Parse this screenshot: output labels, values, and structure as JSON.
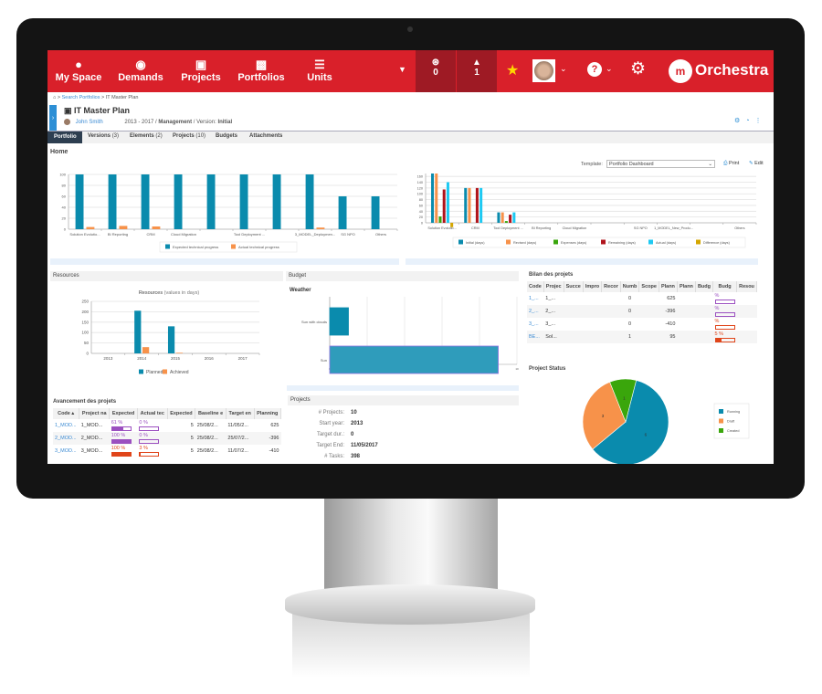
{
  "header": {
    "nav": [
      {
        "label": "My Space",
        "icon": "user-icon"
      },
      {
        "label": "Demands",
        "icon": "lightbulb-icon"
      },
      {
        "label": "Projects",
        "icon": "briefcase-icon"
      },
      {
        "label": "Portfolios",
        "icon": "portfolio-icon"
      },
      {
        "label": "Units",
        "icon": "org-chart-icon"
      }
    ],
    "rss_count": "0",
    "notif_count": "1",
    "brand": "Orchestra",
    "brand_color": "#d9202a"
  },
  "breadcrumb": {
    "link": "Search Portfolios",
    "sep": ">",
    "current": "IT Master Plan"
  },
  "portfolio": {
    "title": "IT Master Plan",
    "owner": "John Smith",
    "meta_prefix": "2013 - 2017 / ",
    "meta_type": "Management",
    "meta_version_label": " / Version: ",
    "meta_version": "Initial"
  },
  "tabs": [
    {
      "label": "Portfolio",
      "count": ""
    },
    {
      "label": "Versions",
      "count": "(3)"
    },
    {
      "label": "Elements",
      "count": "(2)"
    },
    {
      "label": "Projects",
      "count": "(10)"
    },
    {
      "label": "Budgets",
      "count": ""
    },
    {
      "label": "Attachments",
      "count": ""
    }
  ],
  "home": {
    "title": "Home",
    "template_label": "Template:",
    "template_value": "Portfolio Dashboard",
    "print": "Print",
    "edit": "Edit"
  },
  "panels": {
    "resources": "Resources",
    "budget": "Budget",
    "weather": "Weather",
    "bilan": "Bilan des projets",
    "status": "Project Status",
    "avancement": "Avancement des projets",
    "projects": "Projects"
  },
  "chart_data": [
    {
      "type": "bar",
      "categories": [
        "Solution Evolutio...",
        "BI Reporting",
        "CRM",
        "Cloud Migration",
        "",
        "Tool Deployment ...",
        "",
        "3_MODEL_Deploymen...",
        "SG NPO",
        "Others"
      ],
      "series": [
        {
          "name": "Expected technical progress",
          "color": "#0a8bad",
          "values": [
            100,
            100,
            100,
            100,
            100,
            100,
            100,
            100,
            60,
            60
          ]
        },
        {
          "name": "Actual technical progress",
          "color": "#f7924a",
          "values": [
            4,
            6,
            5,
            0,
            0,
            0,
            0,
            3,
            0,
            0
          ]
        }
      ],
      "yticks": [
        0,
        20,
        40,
        60,
        80,
        100
      ],
      "ylim": [
        0,
        100
      ],
      "grid": true,
      "legend": "bottom"
    },
    {
      "type": "bar",
      "categories": [
        "Solution Evolutio...",
        "CRM",
        "Tool Deployment ...",
        "BI Reporting",
        "Cloud Migration",
        "",
        "SG NPO",
        "1_MODEL_New_Produ...",
        "",
        "Others"
      ],
      "series": [
        {
          "name": "Initial (days)",
          "color": "#0a8bad",
          "values": [
            170,
            120,
            36,
            0,
            0,
            0,
            0,
            0,
            0,
            0
          ]
        },
        {
          "name": "Revised (days)",
          "color": "#f7924a",
          "values": [
            170,
            120,
            36,
            0,
            0,
            0,
            0,
            0,
            0,
            0
          ]
        },
        {
          "name": "Expenses (days)",
          "color": "#3aa60c",
          "values": [
            22,
            0,
            6,
            0,
            0,
            0,
            0,
            0,
            0,
            0
          ]
        },
        {
          "name": "Remaining (days)",
          "color": "#b0141c",
          "values": [
            115,
            120,
            28,
            0,
            0,
            0,
            0,
            0,
            0,
            0
          ]
        },
        {
          "name": "Actual (days)",
          "color": "#1ec9f2",
          "values": [
            140,
            120,
            36,
            0,
            0,
            0,
            0,
            0,
            0,
            0
          ]
        },
        {
          "name": "Difference (days)",
          "color": "#d4a600",
          "values": [
            -15,
            0,
            0,
            0,
            0,
            0,
            0,
            0,
            0,
            0
          ]
        }
      ],
      "yticks": [
        0,
        20,
        40,
        60,
        80,
        100,
        120,
        140,
        160
      ],
      "ylim": [
        0,
        170
      ],
      "grid": true,
      "legend": "bottom"
    },
    {
      "type": "bar",
      "title": "Resources",
      "subtitle": "(values in days)",
      "categories": [
        "2013",
        "2014",
        "2015",
        "2016",
        "2017"
      ],
      "series": [
        {
          "name": "Planned",
          "color": "#0a8bad",
          "values": [
            0,
            205,
            130,
            0,
            0
          ]
        },
        {
          "name": "Achieved",
          "color": "#f7924a",
          "values": [
            0,
            30,
            3,
            0,
            0
          ]
        }
      ],
      "yticks": [
        0,
        50,
        100,
        150,
        200,
        250
      ],
      "ylim": [
        0,
        250
      ],
      "grid": true,
      "legend": "bottom"
    },
    {
      "type": "bar",
      "orientation": "horizontal",
      "categories": [
        "Sun with clouds",
        "Sun"
      ],
      "values": [
        1,
        9
      ],
      "xlim": [
        0,
        10
      ],
      "grid": true
    },
    {
      "type": "pie",
      "labels": [
        "Running",
        "Draft",
        "Created"
      ],
      "values": [
        6,
        3,
        1
      ],
      "colors": [
        "#0a8bad",
        "#f7924a",
        "#3aa60c"
      ],
      "legend": "right"
    }
  ],
  "avancement": {
    "columns": [
      "Code",
      "Project na",
      "Expected",
      "Actual tec",
      "Expected",
      "Baseline e",
      "Target en",
      "Planning"
    ],
    "rows": [
      {
        "code": "1_MOD...",
        "name": "1_MOD...",
        "exp": "61 %",
        "exp_pct": 61,
        "act": "0 %",
        "act_pct": 0,
        "n": "5",
        "base": "25/08/2...",
        "target": "11/05/2...",
        "plan": "625",
        "color": "#9b4fc0"
      },
      {
        "code": "2_MOD...",
        "name": "2_MOD...",
        "exp": "100 %",
        "exp_pct": 100,
        "act": "0 %",
        "act_pct": 0,
        "n": "5",
        "base": "25/08/2...",
        "target": "25/07/2...",
        "plan": "-396",
        "color": "#9b4fc0"
      },
      {
        "code": "3_MOD...",
        "name": "3_MOD...",
        "exp": "100 %",
        "exp_pct": 100,
        "act": "3 %",
        "act_pct": 3,
        "n": "5",
        "base": "25/08/2...",
        "target": "11/07/2...",
        "plan": "-410",
        "color": "#e0451a"
      }
    ]
  },
  "projects_info": [
    {
      "k": "# Projects:",
      "v": "10"
    },
    {
      "k": "Start year:",
      "v": "2013"
    },
    {
      "k": "Target dur.:",
      "v": "0"
    },
    {
      "k": "Target End:",
      "v": "11/05/2017"
    },
    {
      "k": "# Tasks:",
      "v": "398"
    }
  ],
  "bilan": {
    "columns": [
      "Code",
      "Projec",
      "Succe",
      "Impro",
      "Recor",
      "Numb",
      "Scope",
      "Plann",
      "Plann",
      "Budg",
      "Budg",
      "Resou"
    ],
    "rows": [
      {
        "code": "1_...",
        "name": "1_...",
        "num": "0",
        "plan": "625",
        "budget": "%",
        "pct": 0,
        "color": "#9b4fc0"
      },
      {
        "code": "2_...",
        "name": "2_...",
        "num": "0",
        "plan": "-396",
        "budget": "%",
        "pct": 0,
        "color": "#9b4fc0"
      },
      {
        "code": "3_...",
        "name": "3_...",
        "num": "0",
        "plan": "-410",
        "budget": "%",
        "pct": 0,
        "color": "#e0451a"
      },
      {
        "code": "BE...",
        "name": "Sol...",
        "num": "1",
        "plan": "95",
        "budget": "5 %",
        "pct": 30,
        "color": "#e0451a"
      }
    ]
  }
}
